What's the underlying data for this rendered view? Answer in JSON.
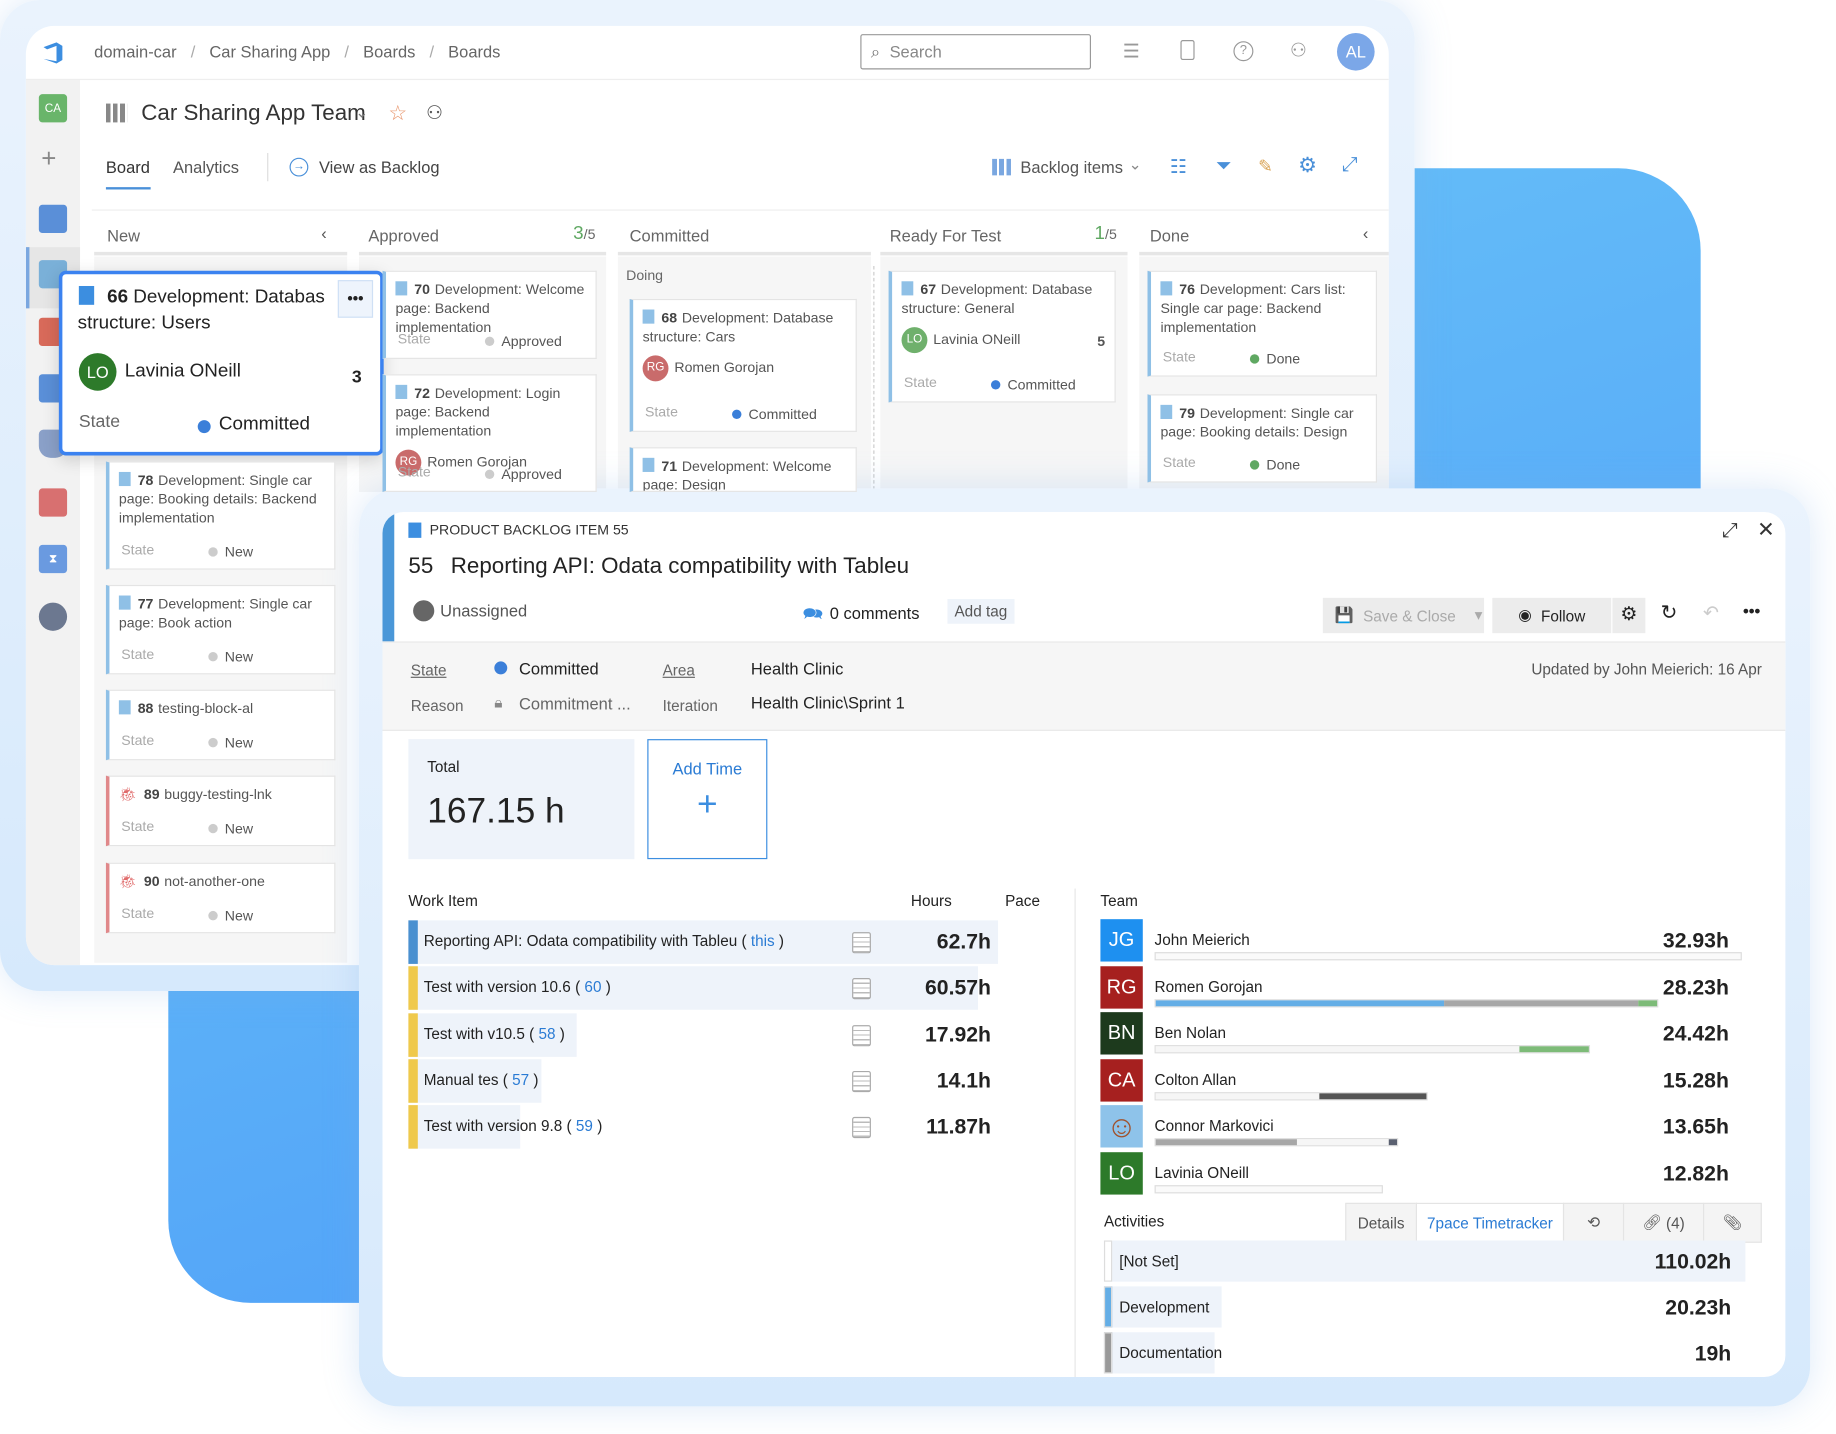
{
  "colors": {
    "accent": "#2a7bd4",
    "committed": "#3b7fd9",
    "done": "#5fa862",
    "new": "#cccccc",
    "approved": "#cccccc"
  },
  "topbar": {
    "breadcrumbs": [
      "domain-car",
      "Car Sharing App",
      "Boards",
      "Boards"
    ],
    "search_placeholder": "Search",
    "avatar": "AL",
    "icons": [
      "logo-icon",
      "task-list-icon",
      "marketplace-bag-icon",
      "help-icon",
      "user-settings-icon"
    ]
  },
  "sidebar": {
    "project_badge": "CA",
    "icons": [
      "plus-icon",
      "overview-icon",
      "boards-icon",
      "repos-icon",
      "pipelines-icon",
      "test-plans-icon",
      "artifacts-icon",
      "timetracker-icon",
      "cat-extension-icon"
    ]
  },
  "team": {
    "name": "Car Sharing App Team"
  },
  "tabs": {
    "board": "Board",
    "analytics": "Analytics",
    "view_as_backlog": "View as Backlog",
    "backlog_items": "Backlog items"
  },
  "columns": [
    {
      "name": "New",
      "count": "",
      "limit": ""
    },
    {
      "name": "Approved",
      "count": "3",
      "limit": "/5"
    },
    {
      "name": "Committed",
      "count": "",
      "limit": "",
      "sub": "Doing"
    },
    {
      "name": "Ready For Test",
      "count": "1",
      "limit": "/5"
    },
    {
      "name": "Done",
      "count": "",
      "limit": ""
    }
  ],
  "state_label": "State",
  "focused_card": {
    "id": "66",
    "title": "Development: Databas structure: Users",
    "assignee": "Lavinia ONeill",
    "initials": "LO",
    "effort": "3",
    "state": "Committed",
    "more": "•••"
  },
  "cards": [
    {
      "col": 0,
      "id": "78",
      "title": "Development: Single car page: Booking details: Backend implementation",
      "state": "New",
      "type": "task"
    },
    {
      "col": 0,
      "id": "77",
      "title": "Development: Single car page: Book action",
      "state": "New",
      "type": "task"
    },
    {
      "col": 0,
      "id": "88",
      "title": "testing-block-al",
      "state": "New",
      "type": "task"
    },
    {
      "col": 0,
      "id": "89",
      "title": "buggy-testing-lnk",
      "state": "New",
      "type": "bug"
    },
    {
      "col": 0,
      "id": "90",
      "title": "not-another-one",
      "state": "New",
      "type": "bug"
    },
    {
      "col": 1,
      "id": "70",
      "title": "Development: Welcome page: Backend implementation",
      "state": "Approved",
      "type": "task"
    },
    {
      "col": 1,
      "id": "72",
      "title": "Development: Login page: Backend implementation",
      "assignee": "Romen Gorojan",
      "initials": "RG",
      "state": "Approved",
      "type": "task"
    },
    {
      "col": 2,
      "id": "68",
      "title": "Development: Database structure: Cars",
      "assignee": "Romen Gorojan",
      "initials": "RG",
      "state": "Committed",
      "type": "task"
    },
    {
      "col": 2,
      "id": "71",
      "title": "Development: Welcome page: Design",
      "state": "",
      "type": "task"
    },
    {
      "col": 3,
      "id": "67",
      "title": "Development: Database structure: General",
      "assignee": "Lavinia ONeill",
      "initials": "LO",
      "effort": "5",
      "state": "Committed",
      "type": "task"
    },
    {
      "col": 4,
      "id": "76",
      "title": "Development: Cars list: Single car page: Backend implementation",
      "state": "Done",
      "type": "task"
    },
    {
      "col": 4,
      "id": "79",
      "title": "Development: Single car page: Booking details: Design",
      "state": "Done",
      "type": "task"
    }
  ],
  "detail": {
    "type_label": "PRODUCT BACKLOG ITEM 55",
    "id": "55",
    "title": "Reporting API: Odata compatibility with Tableu",
    "assignee": "Unassigned",
    "comments": "0 comments",
    "add_tag": "Add tag",
    "save_close": "Save & Close",
    "follow": "Follow",
    "fields": {
      "state_label": "State",
      "state": "Committed",
      "reason_label": "Reason",
      "reason": "Commitment ...",
      "area_label": "Area",
      "area": "Health Clinic",
      "iteration_label": "Iteration",
      "iteration": "Health Clinic\\Sprint 1"
    },
    "updated": "Updated by John Meierich: 16 Apr",
    "tabs": {
      "details": "Details",
      "timetracker": "7pace Timetracker",
      "links": "(4)"
    },
    "total_label": "Total",
    "total": "167.15 h",
    "add_time": "Add Time",
    "add_time_icon": "+",
    "work_header": {
      "item": "Work Item",
      "hours": "Hours",
      "pace": "Pace"
    },
    "work_items": [
      {
        "title": "Reporting API: Odata compatibility with Tableu",
        "ref": "this",
        "hours": 62.7,
        "hours_label": "62.7h",
        "color": "#4a90d0"
      },
      {
        "title": "Test with version 10.6",
        "ref": "60",
        "hours": 60.57,
        "hours_label": "60.57h",
        "color": "#efc94c"
      },
      {
        "title": "Test with v10.5",
        "ref": "58",
        "hours": 17.92,
        "hours_label": "17.92h",
        "color": "#efc94c"
      },
      {
        "title": "Manual tes",
        "ref": "57",
        "hours": 14.1,
        "hours_label": "14.1h",
        "color": "#efc94c"
      },
      {
        "title": "Test with version 9.8",
        "ref": "59",
        "hours": 11.87,
        "hours_label": "11.87h",
        "color": "#efc94c"
      }
    ],
    "team_header": "Team",
    "team": [
      {
        "initials": "JG",
        "name": "John Meierich",
        "hours": 32.93,
        "hours_label": "32.93h",
        "color": "#1e90f0",
        "segments": []
      },
      {
        "initials": "RG",
        "name": "Romen Gorojan",
        "hours": 28.23,
        "hours_label": "28.23h",
        "color": "#a6201f",
        "segments": [
          {
            "color": "#64aee6",
            "frac": 0.575
          },
          {
            "color": "#a7a7a7",
            "frac": 0.387
          },
          {
            "color": "#7dbb78",
            "frac": 0.038
          }
        ]
      },
      {
        "initials": "BN",
        "name": "Ben Nolan",
        "hours": 24.42,
        "hours_label": "24.42h",
        "color": "#1d3a1d",
        "segments": [
          {
            "color": "#f6f6f6",
            "frac": 0.84
          },
          {
            "color": "#7dbb78",
            "frac": 0.16
          }
        ]
      },
      {
        "initials": "CA",
        "name": "Colton Allan",
        "hours": 15.28,
        "hours_label": "15.28h",
        "color": "#a6201f",
        "segments": [
          {
            "color": "#f6f6f6",
            "frac": 0.605
          },
          {
            "color": "#555555",
            "frac": 0.395
          }
        ]
      },
      {
        "initials": "",
        "name": "Connor Markovici",
        "hours": 13.65,
        "hours_label": "13.65h",
        "color": "#8ec3ea",
        "photo": true,
        "segments": [
          {
            "color": "#a7a7a7",
            "frac": 0.585
          },
          {
            "color": "#f6f6f6",
            "frac": 0.38
          },
          {
            "color": "#5a6070",
            "frac": 0.035
          }
        ]
      },
      {
        "initials": "LO",
        "name": "Lavinia ONeill",
        "hours": 12.82,
        "hours_label": "12.82h",
        "color": "#2d7a2a",
        "segments": []
      }
    ],
    "activities_header": "Activities",
    "activities": [
      {
        "name": "[Not Set]",
        "hours": 110.02,
        "hours_label": "110.02h",
        "color": "#ffffff"
      },
      {
        "name": "Development",
        "hours": 20.23,
        "hours_label": "20.23h",
        "color": "#64aee6"
      },
      {
        "name": "Documentation",
        "hours": 19,
        "hours_label": "19h",
        "color": "#999999"
      }
    ]
  }
}
